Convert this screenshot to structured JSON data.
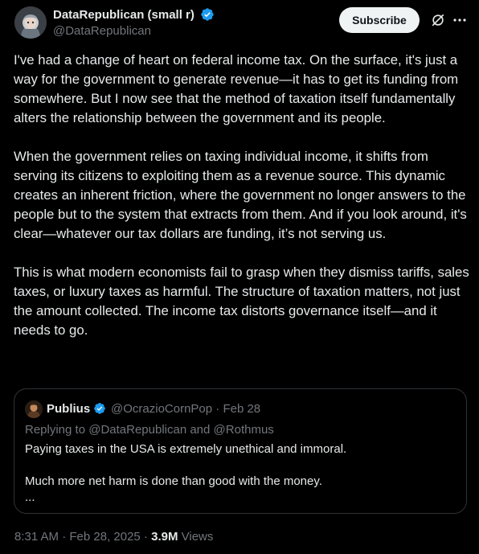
{
  "author": {
    "display_name": "DataRepublican (small r)",
    "handle": "@DataRepublican",
    "verified_icon": "verified-badge-icon",
    "avatar_icon": "avatar-icon"
  },
  "actions": {
    "subscribe_label": "Subscribe",
    "grok_icon": "grok-icon",
    "more_icon": "more-options-icon"
  },
  "tweet": {
    "paragraphs": [
      "I've had a change of heart on federal income tax. On the surface, it's just a way for the government to generate revenue—it has to get its funding from somewhere. But I now see that the method of taxation itself fundamentally alters the relationship between the government and its people.",
      "When the government relies on taxing individual income, it shifts from serving its citizens to exploiting them as a revenue source. This dynamic creates an inherent friction, where the government no longer answers to the people but to the system that extracts from them. And if you look around, it's clear—whatever our tax dollars are funding, it’s not serving us.",
      "This is what modern economists fail to grasp when they dismiss tariffs, sales taxes, or luxury taxes as harmful. The structure of taxation matters, not just the amount collected. The income tax distorts governance itself—and it needs to go."
    ]
  },
  "quote": {
    "display_name": "Publius",
    "handle": "@OcrazioCornPop",
    "separator": "·",
    "date": "Feb 28",
    "replying_to": "Replying to @DataRepublican and @Rothmus",
    "line1": "Paying taxes in the USA is extremely unethical and immoral.",
    "line2": "Much more net harm is done than good with the money.",
    "ellipsis": "..."
  },
  "footer": {
    "timestamp": "8:31 AM · Feb 28, 2025 ·",
    "views_count": "3.9M",
    "views_label": "Views"
  },
  "colors": {
    "background": "#000000",
    "text": "#e7e9ea",
    "muted": "#71767b",
    "verified": "#1d9bf0",
    "border": "#2f3336"
  }
}
